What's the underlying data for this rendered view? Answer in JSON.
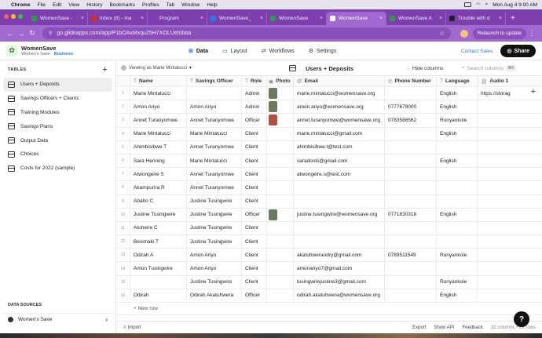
{
  "menubar": {
    "items": [
      "Chrome",
      "File",
      "Edit",
      "View",
      "History",
      "Bookmarks",
      "Profiles",
      "Tab",
      "Window",
      "Help"
    ],
    "clock": "Mon Aug 4  9:00 AM"
  },
  "tabs": [
    {
      "label": "WomenSave -",
      "color": "#2a9d4a"
    },
    {
      "label": "Inbox (8) - ma",
      "color": "#d93025"
    },
    {
      "label": "Program",
      "color": "#7d3cb0"
    },
    {
      "label": "WomenSave_",
      "color": "#2a7be4"
    },
    {
      "label": "WomenSave",
      "color": "#2a9d4a"
    },
    {
      "label": "WomenSave",
      "color": "#ffffff"
    },
    {
      "label": "WomenSave A",
      "color": "#2a9d4a"
    },
    {
      "label": "Trouble with d",
      "color": "#222222"
    }
  ],
  "address": {
    "url": "go.glideapps.com/app/P1bOAxMxqu25H7XOLUet/data",
    "relaunch": "Relaunch to update"
  },
  "app": {
    "name": "WomenSave",
    "subtitle": "Women's Save · ",
    "plan": "Business",
    "nav": {
      "data": "Data",
      "layout": "Layout",
      "workflows": "Workflows",
      "settings": "Settings"
    },
    "contact_sales": "Contact Sales",
    "share": "Share"
  },
  "sidebar": {
    "tables_heading": "TABLES",
    "tables": [
      "Users + Deposits",
      "Savings Officers + Clients",
      "Training Modules",
      "Savings Plans",
      "Output Data",
      "Choices",
      "Costs for 2022 (sample)"
    ],
    "data_sources_heading": "DATA SOURCES",
    "data_source": "Women's Save"
  },
  "toolbar": {
    "viewing_as": "Viewing as Marie Mintalucci",
    "table_title": "Users + Deposits",
    "hide_columns": "Hide columns",
    "search_placeholder": "Search columns",
    "search_shortcut": "⌘K"
  },
  "columns": {
    "name": "Name",
    "officer": "Savings Officer",
    "role": "Role",
    "photo": "Photo",
    "email": "Email",
    "phone": "Phone Number",
    "language": "Language",
    "audio": "Audio 1"
  },
  "rows": [
    {
      "idx": "1",
      "name": "Marie Mintalucci",
      "officer": "",
      "role": "Admin",
      "photo": "yes",
      "email": "marie.mintalucci@womensave.org",
      "phone": "",
      "language": "English",
      "audio": "https://storag"
    },
    {
      "idx": "2",
      "name": "Amon Ariyo",
      "officer": "Amon Ariyo",
      "role": "Admin",
      "photo": "yes",
      "email": "amon.ariyo@womensave.org",
      "phone": "0777679000",
      "language": "English",
      "audio": ""
    },
    {
      "idx": "3",
      "name": "Annet  Turanyomwe",
      "officer": "Annet Turanyomwe",
      "role": "Officer",
      "photo": "alt",
      "email": "annet.turanyomwe@womensave.org",
      "phone": "0783586562",
      "language": "Runyankole",
      "audio": ""
    },
    {
      "idx": "4",
      "name": "Marie Mintalucci",
      "officer": "Marie Mintalucci",
      "role": "Client",
      "photo": "",
      "email": "marie.mintalucci@gmail.com",
      "phone": "",
      "language": "English",
      "audio": ""
    },
    {
      "idx": "5",
      "name": "Ahimbisibwe T",
      "officer": "Annet Turanyomwe",
      "role": "Client",
      "photo": "",
      "email": "ahimbisibwe.t@test.com",
      "phone": "",
      "language": "",
      "audio": ""
    },
    {
      "idx": "6",
      "name": "Sara Henning",
      "officer": "Marie Mintalucci",
      "role": "Client",
      "photo": "",
      "email": "saradools@gmail.com",
      "phone": "",
      "language": "English",
      "audio": ""
    },
    {
      "idx": "7",
      "name": "Atwongeire S",
      "officer": "Annet Turanyomwe",
      "role": "Client",
      "photo": "",
      "email": "atwongeire.s@test.com",
      "phone": "",
      "language": "",
      "audio": ""
    },
    {
      "idx": "8",
      "name": "Akampurira R",
      "officer": "Annet Turanyomwe",
      "role": "Client",
      "photo": "",
      "email": "",
      "phone": "",
      "language": "",
      "audio": ""
    },
    {
      "idx": "9",
      "name": "Abaho   C",
      "officer": "Justine Tusingwire",
      "role": "Client",
      "photo": "",
      "email": "",
      "phone": "",
      "language": "",
      "audio": ""
    },
    {
      "idx": "10",
      "name": "Justine Tusingwire",
      "officer": "Justine Tusingwire",
      "role": "Officer",
      "photo": "yes",
      "email": "justine.tusingwire@womensave.org",
      "phone": "0771830318",
      "language": "English",
      "audio": ""
    },
    {
      "idx": "11",
      "name": "Atuheire C",
      "officer": "Justine Tusingwire",
      "role": "Client",
      "photo": "",
      "email": "",
      "phone": "",
      "language": "",
      "audio": ""
    },
    {
      "idx": "12",
      "name": "Besimaki  T",
      "officer": "Justine Tusingwire",
      "role": "Client",
      "photo": "",
      "email": "",
      "phone": "",
      "language": "",
      "audio": ""
    },
    {
      "idx": "13",
      "name": "Odirah A",
      "officer": "Amon Ariyo",
      "role": "Client",
      "photo": "",
      "email": "akatuhweraodry@gmail.com",
      "phone": "0789511549",
      "language": "Runyankole",
      "audio": ""
    },
    {
      "idx": "14",
      "name": "Amon Tusingwire",
      "officer": "Amon Ariyo",
      "role": "Client",
      "photo": "",
      "email": "amonariyo7@gmail.com",
      "phone": "",
      "language": "",
      "audio": ""
    },
    {
      "idx": "15",
      "name": "",
      "officer": "Justine Tusingwire",
      "role": "Client",
      "photo": "",
      "email": "tusingwirejustine3@gmail.com",
      "phone": "",
      "language": "Runyankole",
      "audio": ""
    },
    {
      "idx": "16",
      "name": "Odirah",
      "officer": "Odirah Akatuhwera",
      "role": "Officer",
      "photo": "",
      "email": "odirah.akatuhwera@womensave.org",
      "phone": "",
      "language": "English",
      "audio": ""
    }
  ],
  "new_row": "+ New row",
  "footer": {
    "import": "Import",
    "export": "Export",
    "show_api": "Show API",
    "feedback": "Feedback",
    "counts": "32 columns • 69 rows"
  },
  "help": "?"
}
